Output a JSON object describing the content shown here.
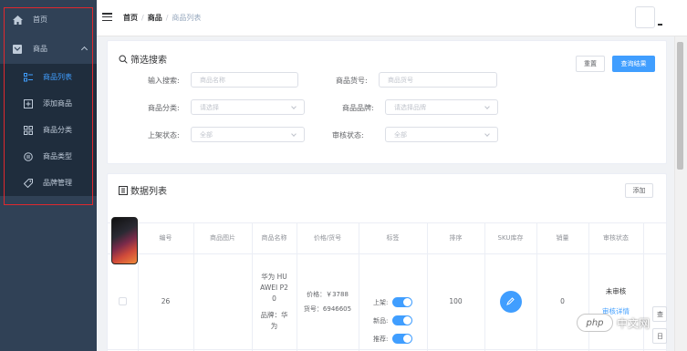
{
  "sidebar": {
    "home_label": "首页",
    "goods_label": "商品",
    "items": [
      {
        "label": "商品列表"
      },
      {
        "label": "添加商品"
      },
      {
        "label": "商品分类"
      },
      {
        "label": "商品类型"
      },
      {
        "label": "品牌管理"
      }
    ]
  },
  "breadcrumb": {
    "home": "首页",
    "goods": "商品",
    "current": "商品列表"
  },
  "search": {
    "title": "筛选搜索",
    "reset_label": "重置",
    "query_label": "查询结果",
    "keyword_label": "输入搜索:",
    "keyword_placeholder": "商品名称",
    "sn_label": "商品货号:",
    "sn_placeholder": "商品货号",
    "category_label": "商品分类:",
    "category_placeholder": "请选择",
    "brand_label": "商品品牌:",
    "brand_placeholder": "请选择品牌",
    "publish_label": "上架状态:",
    "publish_value": "全部",
    "verify_label": "审核状态:",
    "verify_value": "全部"
  },
  "list": {
    "title": "数据列表",
    "add_label": "添加",
    "columns": [
      "编号",
      "商品图片",
      "商品名称",
      "价格/货号",
      "标签",
      "排序",
      "SKU库存",
      "销量",
      "审核状态"
    ],
    "row": {
      "id": "26",
      "name_lines": [
        "华为 HU",
        "AWEI P2",
        "0"
      ],
      "brand_lines": [
        "品牌：华",
        "为"
      ],
      "price": "价格：￥3788",
      "sn": "货号：6946605",
      "tag_publish": "上架:",
      "tag_new": "新品:",
      "tag_recommend": "推荐:",
      "sort": "100",
      "sales": "0",
      "verify_status": "未审核",
      "verify_detail": "审核详情",
      "op1": "查",
      "op2": "日"
    }
  },
  "watermark": {
    "logo": "php",
    "text": "中文网"
  }
}
